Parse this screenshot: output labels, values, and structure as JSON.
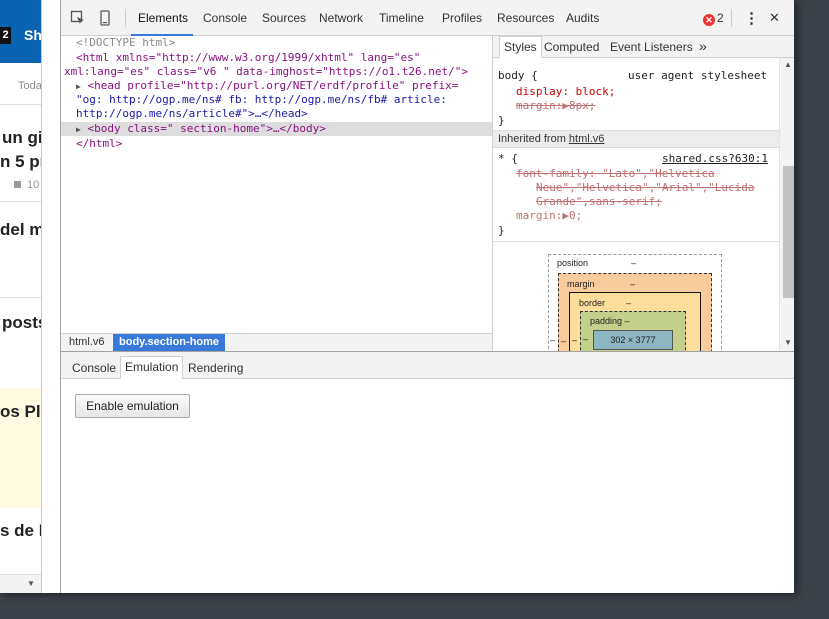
{
  "page": {
    "badge": "2",
    "top_word": "Sh",
    "nav_text": "Toda",
    "headlines": [
      "un gi",
      "n 5 pr",
      "del mu",
      "posts",
      "os Pla",
      "s de H"
    ],
    "comment_count": "10"
  },
  "toolbar": {
    "tabs": [
      "Elements",
      "Console",
      "Sources",
      "Network",
      "Timeline",
      "Profiles",
      "Resources",
      "Audits"
    ],
    "active_tab": "Elements",
    "error_count": "2",
    "more_symbol": "⋮",
    "close_symbol": "✕"
  },
  "dom": {
    "doctype": "<!DOCTYPE html>",
    "html_open_1": "<html xmlns=\"http://www.w3.org/1999/xhtml\" lang=\"es\"",
    "html_open_2": "xml:lang=\"es\" class=\"v6 \" data-imghost=\"https://o1.t26.net/\">",
    "head_1": "<head profile=\"http://purl.org/NET/erdf/profile\" prefix=",
    "head_2": "\"og: http://ogp.me/ns# fb: http://ogp.me/ns/fb# article:",
    "head_3": "http://ogp.me/ns/article#\">…</head>",
    "body_line": "<body class=\" section-home\">…</body>",
    "html_close": "</html>"
  },
  "breadcrumbs": [
    "html.v6",
    "body.section-home"
  ],
  "styles": {
    "tabs": [
      "Styles",
      "Computed",
      "Event Listeners"
    ],
    "more": "»",
    "rule1_selector": "body {",
    "rule1_source": "user agent stylesheet",
    "rule1_prop1": "display: block;",
    "rule1_prop2": "margin:▶8px;",
    "rule_close": "}",
    "inherited_label": "Inherited from ",
    "inherited_link": "html.v6",
    "rule2_selector": "* {",
    "rule2_source": "shared.css?630:1",
    "rule2_line1": "font-family: \"Lato\",\"Helvetica",
    "rule2_line2": "Neue\",\"Helvetica\",\"Arial\",\"Lucida",
    "rule2_line3": "Grande\",sans-serif;",
    "rule2_prop2": "margin:▶0;"
  },
  "box_model": {
    "position": "position",
    "position_val": "–",
    "margin": "margin",
    "margin_val": "–",
    "border": "border",
    "border_val": "–",
    "padding": "padding –",
    "content": "302 × 3777",
    "side_dash": "–"
  },
  "drawer": {
    "tabs": [
      "Console",
      "Emulation",
      "Rendering"
    ],
    "active_tab": "Emulation",
    "enable_button": "Enable emulation"
  }
}
